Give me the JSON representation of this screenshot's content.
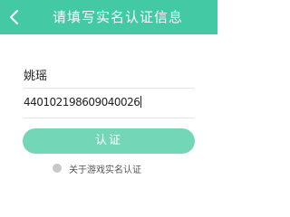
{
  "header": {
    "title": "请填写实名认证信息",
    "background_color": "#43c9a4",
    "back_icon": "chevron-left-icon"
  },
  "form": {
    "name_value": "姚瑶",
    "id_number_value": "440102198609040026"
  },
  "submit_button": {
    "label": "认证",
    "color": "#73d6b7"
  },
  "about_link": {
    "label": "关于游戏实名认证",
    "icon": "radio-icon"
  }
}
